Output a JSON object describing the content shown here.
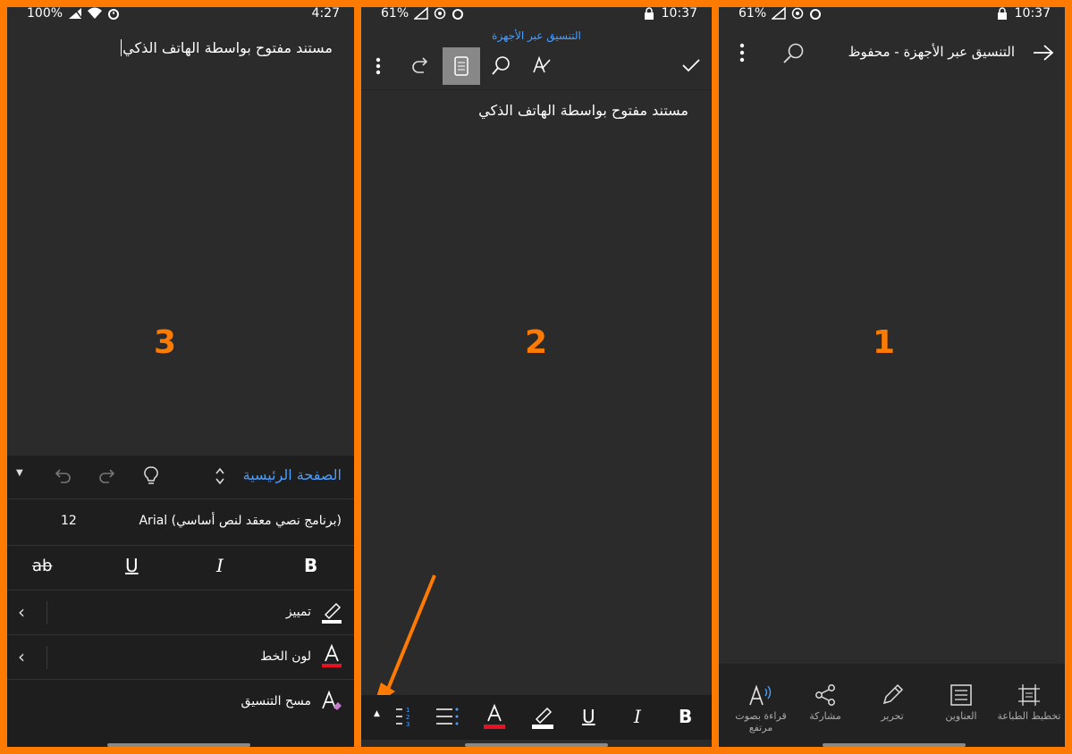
{
  "panel3": {
    "number": "3",
    "status": {
      "battery": "100%",
      "time": "4:27"
    },
    "doc_text": "مستند مفتوح بواسطة الهاتف الذكي",
    "ribbon": {
      "tab_label": "الصفحة الرئيسية",
      "font_name": "(برنامج نصي معقد لنص أساسي) Arial",
      "font_size": "12",
      "bold": "B",
      "italic": "I",
      "underline": "U",
      "strike": "ab",
      "highlight_label": "تمييز",
      "font_color_label": "لون الخط",
      "clear_format_label": "مسح التنسيق"
    }
  },
  "panel2": {
    "number": "2",
    "status": {
      "battery": "61%",
      "time": "10:37"
    },
    "title": "التنسيق عبر الأجهزة",
    "doc_text": "مستند مفتوح بواسطة الهاتف الذكي",
    "bottom": {
      "bold": "B",
      "italic": "I",
      "underline": "U"
    }
  },
  "panel1": {
    "number": "1",
    "status": {
      "battery": "61%",
      "time": "10:37"
    },
    "title": "التنسيق عبر الأجهزة - محفوظ",
    "nav": {
      "layout": "تخطيط الطباعة",
      "headings": "العناوين",
      "edit": "تحرير",
      "share": "مشاركة",
      "read_aloud": "قراءة بصوت مرتفع"
    }
  },
  "colors": {
    "frame": "#ff7a00",
    "panel_bg": "#2b2b2b",
    "accent_blue": "#4a9eff",
    "red": "#e81123"
  }
}
